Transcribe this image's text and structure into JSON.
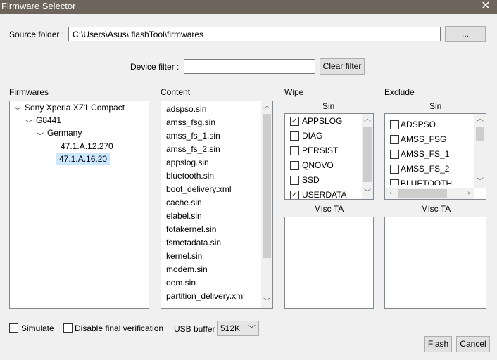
{
  "window": {
    "title": "Firmware Selector",
    "close_glyph": "✕"
  },
  "source": {
    "label": "Source folder :",
    "value": "C:\\Users\\Asus\\.flashTool\\firmwares",
    "browse_label": "..."
  },
  "device_filter": {
    "label": "Device filter :",
    "value": "",
    "clear_label": "Clear filter"
  },
  "firmwares": {
    "label": "Firmwares",
    "tree": [
      {
        "label": "Sony Xperia XZ1 Compact",
        "expanded": true
      },
      {
        "label": "G8441",
        "expanded": true
      },
      {
        "label": "Germany",
        "expanded": true
      },
      {
        "label": "47.1.A.12.270"
      },
      {
        "label": "47.1.A.16.20",
        "selected": true
      }
    ]
  },
  "content": {
    "label": "Content",
    "items": [
      "adspso.sin",
      "amss_fsg.sin",
      "amss_fs_1.sin",
      "amss_fs_2.sin",
      "appslog.sin",
      "bluetooth.sin",
      "boot_delivery.xml",
      "cache.sin",
      "elabel.sin",
      "fotakernel.sin",
      "fsmetadata.sin",
      "kernel.sin",
      "modem.sin",
      "oem.sin",
      "partition_delivery.xml"
    ]
  },
  "wipe": {
    "label": "Wipe",
    "sin_header": "Sin",
    "items": [
      {
        "label": "APPSLOG",
        "checked": true
      },
      {
        "label": "DIAG",
        "checked": false
      },
      {
        "label": "PERSIST",
        "checked": false
      },
      {
        "label": "QNOVO",
        "checked": false
      },
      {
        "label": "SSD",
        "checked": false
      },
      {
        "label": "USERDATA",
        "checked": true
      }
    ],
    "misc_header": "Misc TA"
  },
  "exclude": {
    "label": "Exclude",
    "sin_header": "Sin",
    "items": [
      {
        "label": "ADSPSO",
        "checked": false
      },
      {
        "label": "AMSS_FSG",
        "checked": false
      },
      {
        "label": "AMSS_FS_1",
        "checked": false
      },
      {
        "label": "AMSS_FS_2",
        "checked": false
      },
      {
        "label": "BLUETOOTH",
        "checked": false
      }
    ],
    "misc_header": "Misc TA"
  },
  "options": {
    "simulate_label": "Simulate",
    "simulate_checked": false,
    "disable_verification_label": "Disable final verification",
    "disable_verification_checked": false,
    "usb_buffer_label": "USB buffer",
    "usb_buffer_value": "512K"
  },
  "actions": {
    "flash_label": "Flash",
    "cancel_label": "Cancel"
  }
}
